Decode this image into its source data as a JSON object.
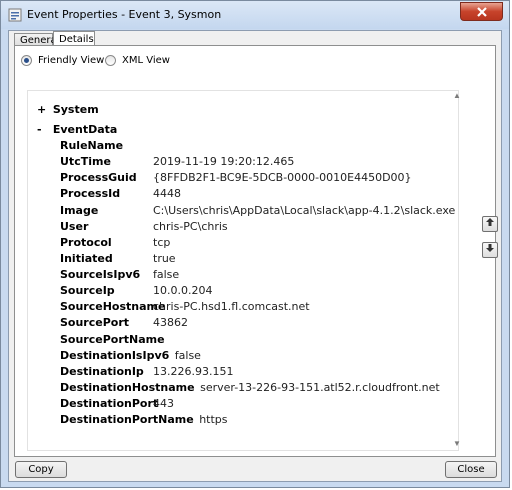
{
  "window": {
    "title": "Event Properties - Event 3, Sysmon",
    "close_icon": "close-x-icon"
  },
  "tabs": [
    {
      "label": "General",
      "selected": false
    },
    {
      "label": "Details",
      "selected": true
    }
  ],
  "view_options": {
    "friendly": {
      "label": "Friendly View",
      "selected": true
    },
    "xml": {
      "label": "XML View",
      "selected": false
    }
  },
  "sections": {
    "system": {
      "toggle": "+",
      "label": "System"
    },
    "eventdata": {
      "toggle": "-",
      "label": "EventData"
    }
  },
  "fields": [
    {
      "key": "RuleName",
      "value": ""
    },
    {
      "key": "UtcTime",
      "value": "2019-11-19 19:20:12.465"
    },
    {
      "key": "ProcessGuid",
      "value": "{8FFDB2F1-BC9E-5DCB-0000-0010E4450D00}"
    },
    {
      "key": "ProcessId",
      "value": "4448"
    },
    {
      "key": "Image",
      "value": "C:\\Users\\chris\\AppData\\Local\\slack\\app-4.1.2\\slack.exe"
    },
    {
      "key": "User",
      "value": "chris-PC\\chris"
    },
    {
      "key": "Protocol",
      "value": "tcp"
    },
    {
      "key": "Initiated",
      "value": "true"
    },
    {
      "key": "SourceIsIpv6",
      "value": "false"
    },
    {
      "key": "SourceIp",
      "value": "10.0.0.204"
    },
    {
      "key": "SourceHostname",
      "value": "chris-PC.hsd1.fl.comcast.net"
    },
    {
      "key": "SourcePort",
      "value": "43862"
    },
    {
      "key": "SourcePortName",
      "value": ""
    },
    {
      "key": "DestinationIsIpv6",
      "value": "false"
    },
    {
      "key": "DestinationIp",
      "value": "13.226.93.151"
    },
    {
      "key": "DestinationHostname",
      "value": "server-13-226-93-151.atl52.r.cloudfront.net"
    },
    {
      "key": "DestinationPort",
      "value": "443"
    },
    {
      "key": "DestinationPortName",
      "value": "https"
    }
  ],
  "side_buttons": {
    "up_icon": "arrow-up-icon",
    "down_icon": "arrow-down-icon"
  },
  "buttons": {
    "copy": "Copy",
    "close": "Close"
  },
  "colors": {
    "titlebar": "#c4d7ef",
    "close_button": "#c7432b"
  }
}
